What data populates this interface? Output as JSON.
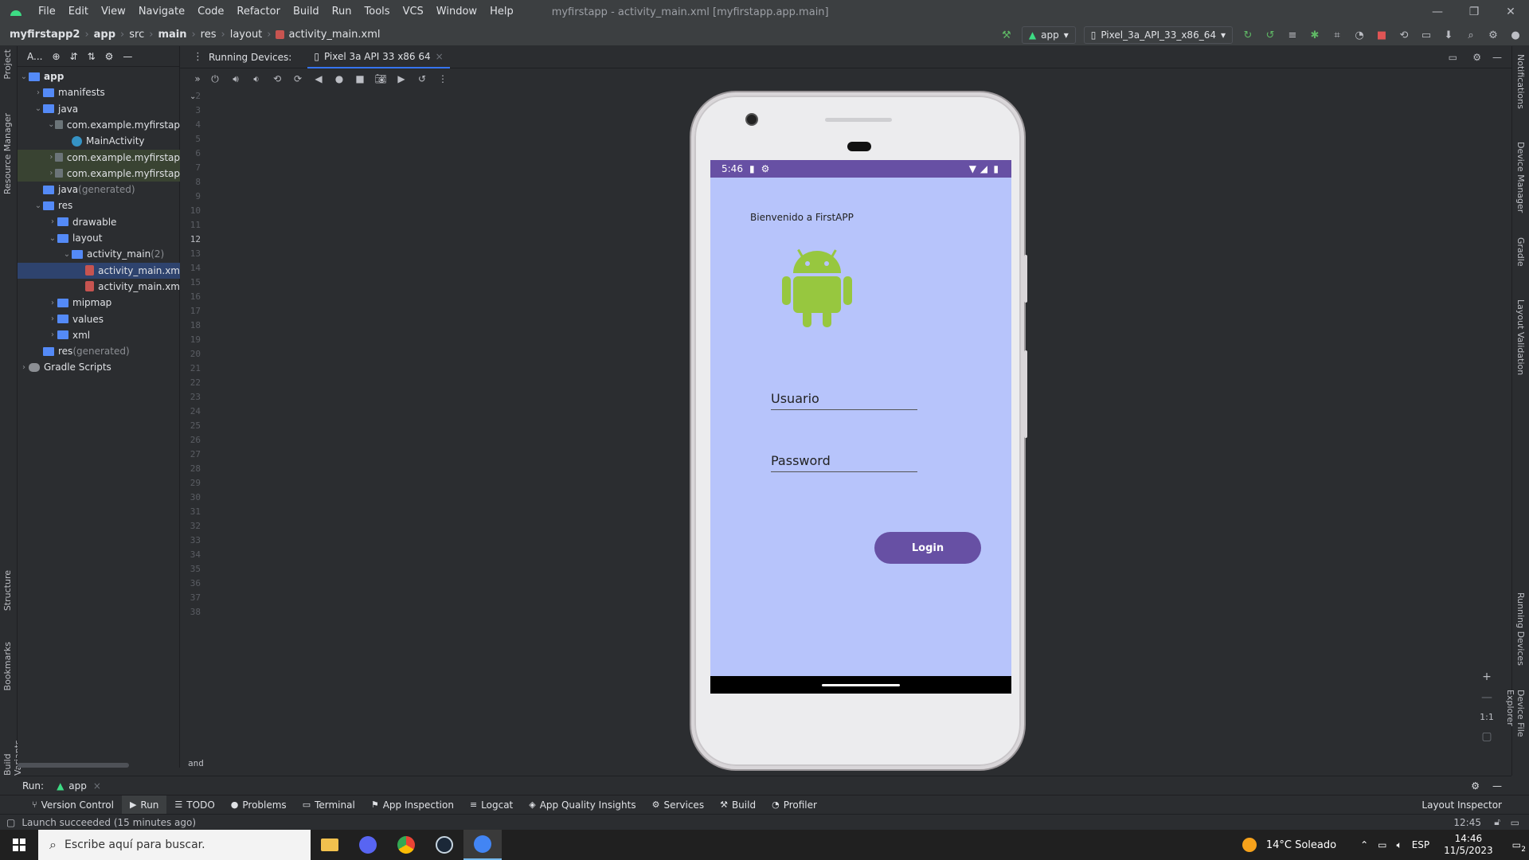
{
  "window": {
    "title": "myfirstapp - activity_main.xml [myfirstapp.app.main]",
    "menus": [
      "File",
      "Edit",
      "View",
      "Navigate",
      "Code",
      "Refactor",
      "Build",
      "Run",
      "Tools",
      "VCS",
      "Window",
      "Help"
    ]
  },
  "breadcrumb": [
    "myfirstapp2",
    "app",
    "src",
    "main",
    "res",
    "layout",
    "activity_main.xml"
  ],
  "toolbar": {
    "run_config": "app",
    "device": "Pixel_3a_API_33_x86_64"
  },
  "project": {
    "header": "A...",
    "tree": [
      {
        "label": "app",
        "indent": 0,
        "type": "module",
        "chev": "v"
      },
      {
        "label": "manifests",
        "indent": 1,
        "type": "folder",
        "chev": ">"
      },
      {
        "label": "java",
        "indent": 1,
        "type": "folder",
        "chev": "v"
      },
      {
        "label": "com.example.myfirstap",
        "indent": 2,
        "type": "pkg",
        "chev": "v"
      },
      {
        "label": "MainActivity",
        "indent": 3,
        "type": "class",
        "chev": ""
      },
      {
        "label": "com.example.myfirstap",
        "indent": 2,
        "type": "pkg",
        "chev": ">",
        "hl": true
      },
      {
        "label": "com.example.myfirstap",
        "indent": 2,
        "type": "pkg",
        "chev": ">",
        "hl": true
      },
      {
        "label": "java",
        "suffix": " (generated)",
        "indent": 1,
        "type": "folder",
        "chev": ""
      },
      {
        "label": "res",
        "indent": 1,
        "type": "folder",
        "chev": "v"
      },
      {
        "label": "drawable",
        "indent": 2,
        "type": "folder",
        "chev": ">"
      },
      {
        "label": "layout",
        "indent": 2,
        "type": "folder",
        "chev": "v"
      },
      {
        "label": "activity_main",
        "suffix": " (2)",
        "indent": 3,
        "type": "folder",
        "chev": "v"
      },
      {
        "label": "activity_main.xm",
        "indent": 4,
        "type": "xml",
        "chev": "",
        "sel": true
      },
      {
        "label": "activity_main.xm",
        "indent": 4,
        "type": "xml",
        "chev": ""
      },
      {
        "label": "mipmap",
        "indent": 2,
        "type": "folder",
        "chev": ">"
      },
      {
        "label": "values",
        "indent": 2,
        "type": "folder",
        "chev": ">"
      },
      {
        "label": "xml",
        "indent": 2,
        "type": "folder",
        "chev": ">"
      },
      {
        "label": "res",
        "suffix": " (generated)",
        "indent": 1,
        "type": "folder",
        "chev": ""
      },
      {
        "label": "Gradle Scripts",
        "indent": 0,
        "type": "gradle",
        "chev": ">"
      }
    ]
  },
  "left_tabs": [
    "Project",
    "Resource Manager",
    "Structure",
    "Bookmarks",
    "Build Variants"
  ],
  "right_tabs": [
    "Notifications",
    "Device Manager",
    "Gradle",
    "Layout Validation",
    "Running Devices",
    "Device File Explorer"
  ],
  "gutter": {
    "lines": [
      "2",
      "3",
      "4",
      "5",
      "6",
      "7",
      "8",
      "9",
      "10",
      "11",
      "12",
      "13",
      "14",
      "15",
      "16",
      "17",
      "18",
      "19",
      "20",
      "21",
      "22",
      "23",
      "24",
      "25",
      "26",
      "27",
      "28",
      "29",
      "30",
      "31",
      "32",
      "33",
      "34",
      "35",
      "36",
      "37",
      "38"
    ],
    "footer": "and"
  },
  "running_devices": {
    "title": "Running Devices:",
    "tab": "Pixel 3a API 33 x86 64"
  },
  "phone": {
    "time": "5:46",
    "welcome": "Bienvenido a FirstAPP",
    "username_hint": "Usuario",
    "password_hint": "Password",
    "login_label": "Login",
    "colors": {
      "primary": "#6750a4",
      "background": "#b7c4fb"
    }
  },
  "zoom": {
    "one_to_one": "1:1"
  },
  "run": {
    "label": "Run:",
    "config": "app"
  },
  "bottom_tabs": [
    "Version Control",
    "Run",
    "TODO",
    "Problems",
    "Terminal",
    "App Inspection",
    "Logcat",
    "App Quality Insights",
    "Services",
    "Build",
    "Profiler"
  ],
  "layout_inspector": "Layout Inspector",
  "status": {
    "message": "Launch succeeded (15 minutes ago)",
    "position": "12:45"
  },
  "taskbar": {
    "search_placeholder": "Escribe aquí para buscar.",
    "weather": "14°C  Soleado",
    "lang": "ESP",
    "time": "14:46",
    "date": "11/5/2023",
    "notif_count": "2"
  }
}
